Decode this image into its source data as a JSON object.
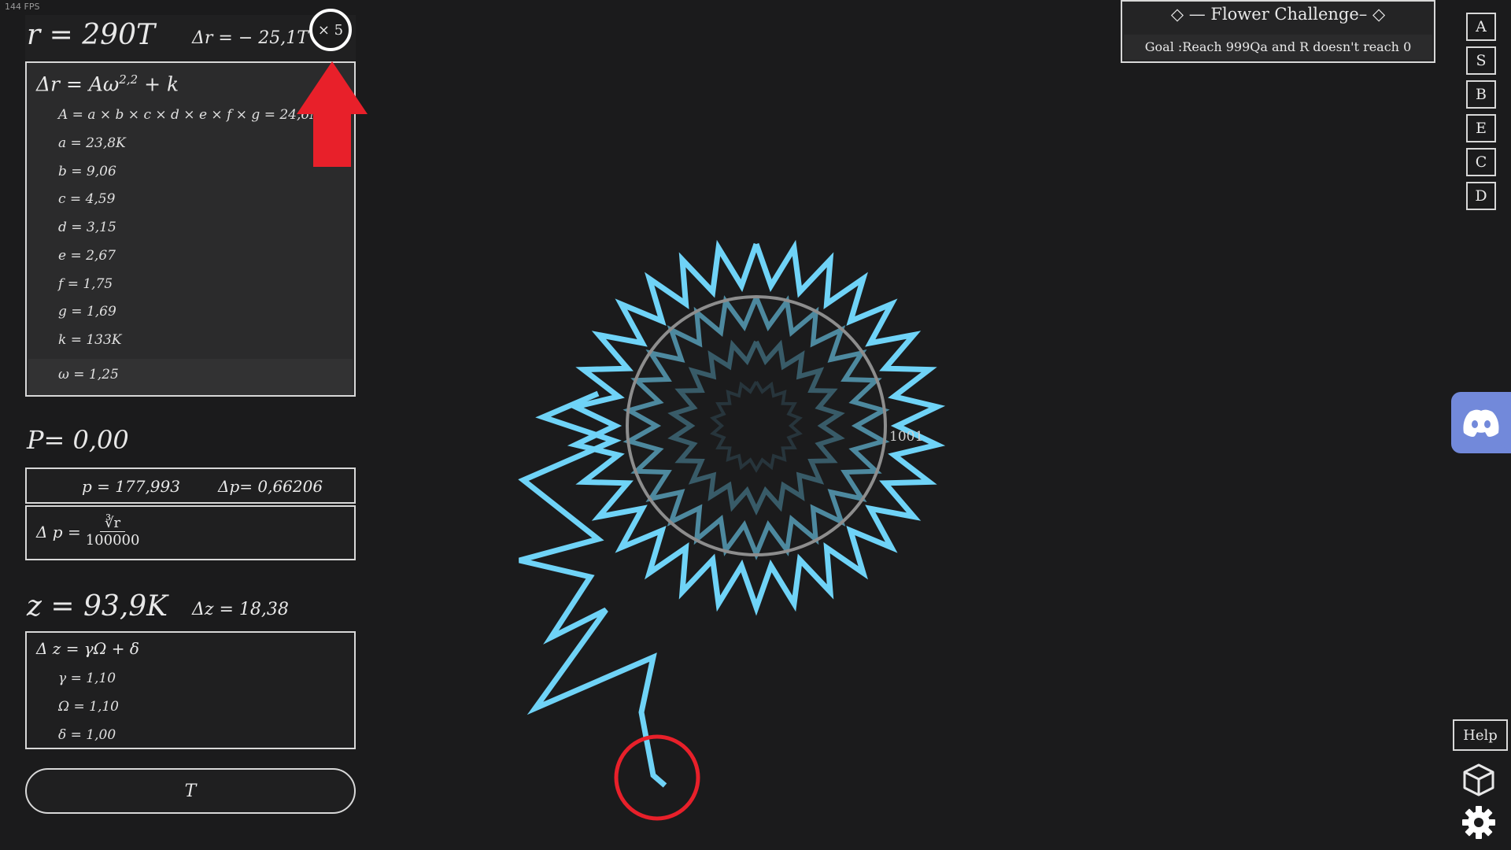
{
  "fps": "144 FPS",
  "r": {
    "label": "r = 290T",
    "delta": "Δr = − 25,1T"
  },
  "multiplier": "× 5",
  "formula": {
    "title": "Δr = Aω",
    "exponent": "2,2",
    "suffix": "+ k",
    "rows": [
      "A = a × b × c × d × e × f × g = 24,6M",
      "a = 23,8K",
      "b = 9,06",
      "c = 4,59",
      "d = 3,15",
      "e = 2,67",
      "f = 1,75",
      "g = 1,69",
      "k = 133K"
    ],
    "omega": "ω = 1,25"
  },
  "p": {
    "label": "P= 0,00",
    "value": "p = 177,993",
    "delta": "Δp= 0,66206",
    "formula_lhs": "Δ p =",
    "formula_num": "∛r",
    "formula_den": "100000"
  },
  "z": {
    "label": "z = 93,9K",
    "delta": "Δz = 18,38",
    "formula": "Δ z = γΩ + δ",
    "rows": [
      "γ = 1,10",
      "Ω = 1,10",
      "δ = 1,00"
    ]
  },
  "t_button": "T",
  "challenge": {
    "title": "◇ — Flower Challenge– ◇",
    "goal": "Goal :Reach 999Qa and R doesn't reach 0"
  },
  "nav": [
    "A",
    "S",
    "B",
    "E",
    "C",
    "D"
  ],
  "help": "Help",
  "spiral_label": "1001",
  "colors": {
    "background": "#1b1b1c",
    "spiral": "#6fd3f7",
    "annotation": "#e8202a",
    "discord": "#7289da"
  },
  "icons": {
    "discord": "discord-icon",
    "cube": "cube-icon",
    "settings": "gear-icon"
  }
}
